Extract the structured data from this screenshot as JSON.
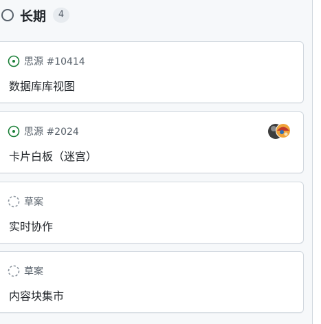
{
  "column": {
    "title": "长期",
    "count": "4",
    "status_icon": "circle-outline-icon"
  },
  "cards": [
    {
      "status_icon": "open-issue-icon",
      "meta": "思源 #10414",
      "title": "数据库库视图",
      "accent": "#1a7f37"
    },
    {
      "status_icon": "open-issue-icon",
      "meta": "思源 #2024",
      "title": "卡片白板（迷宫）",
      "accent": "#1a7f37",
      "avatars": "assignee-avatars"
    },
    {
      "status_icon": "draft-icon",
      "meta": "草案",
      "title": "实时协作",
      "accent": "#8c959f"
    },
    {
      "status_icon": "draft-icon",
      "meta": "草案",
      "title": "内容块集市",
      "accent": "#8c959f"
    }
  ]
}
